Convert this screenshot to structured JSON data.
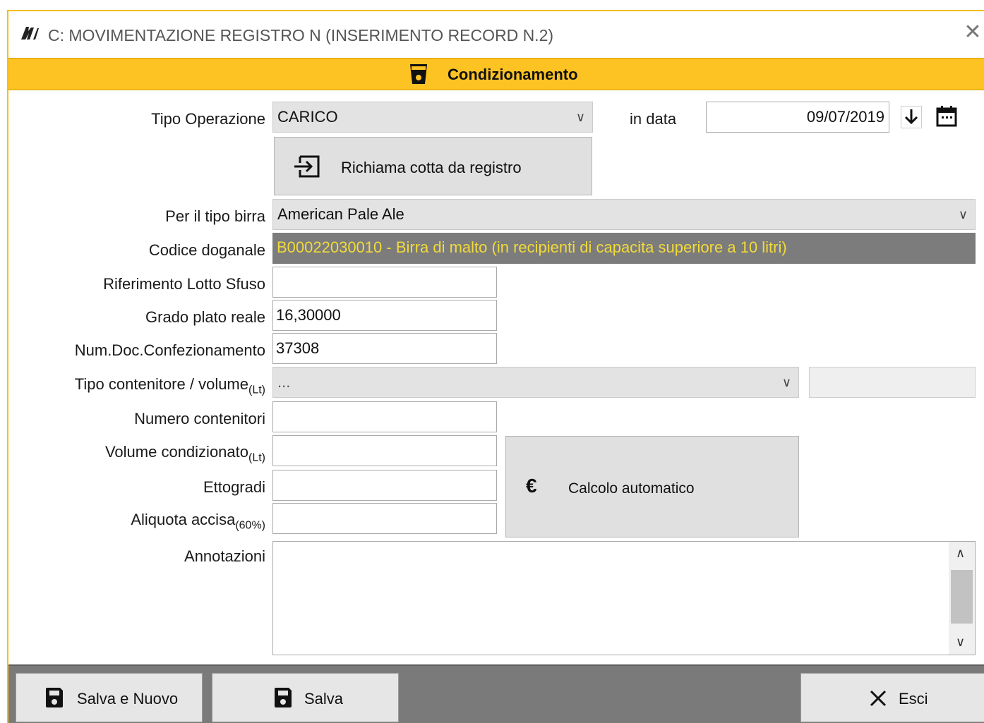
{
  "window": {
    "title": "C: MOVIMENTAZIONE REGISTRO N (INSERIMENTO RECORD N.2)",
    "accent_color": "#fdc322"
  },
  "header": {
    "title": "Condizionamento",
    "icon": "cup-icon"
  },
  "form": {
    "tipo_operazione": {
      "label": "Tipo Operazione",
      "value": "CARICO"
    },
    "in_data": {
      "label": "in data",
      "value": "09/07/2019"
    },
    "richiama_button": {
      "label": "Richiama cotta da registro",
      "icon": "import-icon"
    },
    "tipo_birra": {
      "label": "Per il tipo birra",
      "value": "American Pale Ale"
    },
    "codice_doganale": {
      "label": "Codice doganale",
      "value": "B00022030010 - Birra di malto (in recipienti di capacita  superiore a 10 litri)"
    },
    "riferimento_lotto": {
      "label": "Riferimento Lotto Sfuso",
      "value": ""
    },
    "grado_plato": {
      "label": "Grado plato reale",
      "value": "16,30000"
    },
    "num_doc": {
      "label": "Num.Doc.Confezionamento",
      "value": "37308"
    },
    "tipo_contenitore": {
      "label": "Tipo contenitore / volume",
      "unit": "(Lt)",
      "value": "...",
      "volume": ""
    },
    "numero_contenitori": {
      "label": "Numero contenitori",
      "value": ""
    },
    "volume_condizionato": {
      "label": "Volume condizionato",
      "unit": "(Lt)",
      "value": ""
    },
    "ettogradi": {
      "label": "Ettogradi",
      "value": ""
    },
    "aliquota_accisa": {
      "label": "Aliquota accisa",
      "unit": "(60%)",
      "value": ""
    },
    "calcolo_button": {
      "label": "Calcolo automatico",
      "icon": "euro-icon"
    },
    "annotazioni": {
      "label": "Annotazioni",
      "value": ""
    }
  },
  "footer": {
    "salva_nuovo": "Salva e Nuovo",
    "salva": "Salva",
    "esci": "Esci"
  }
}
